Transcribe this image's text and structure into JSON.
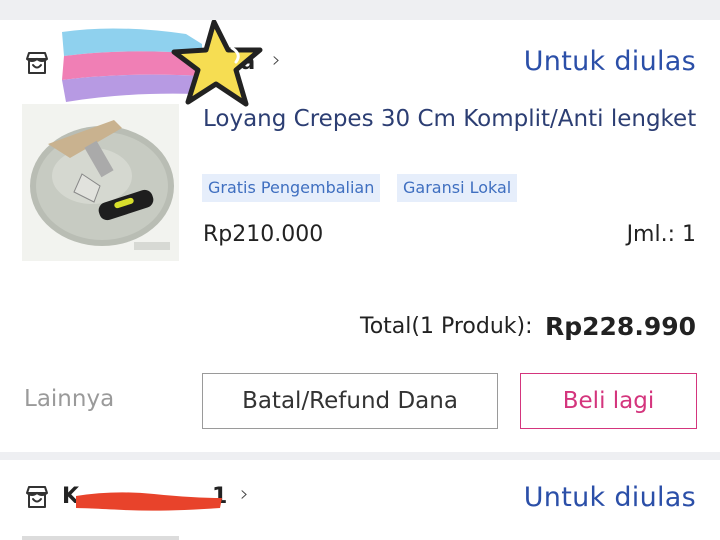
{
  "orders": [
    {
      "store_name": "ya",
      "status": "Untuk diulas",
      "product": {
        "title": "Loyang Crepes 30 Cm Komplit/Anti lengket",
        "badges": [
          "Gratis Pengembalian",
          "Garansi Lokal"
        ],
        "price": "Rp210.000",
        "qty": "Jml.: 1"
      },
      "total_label": "Total(1 Produk):",
      "total_value": "Rp228.990",
      "more_label": "Lainnya",
      "refund_label": "Batal/Refund Dana",
      "buy_again_label": "Beli lagi"
    },
    {
      "store_name": "K",
      "store_name_end": "1",
      "status": "Untuk diulas"
    }
  ],
  "icons": [
    "store-icon",
    "chevron-right-icon"
  ],
  "colors": {
    "accent": "#d4357d",
    "status_text": "#2b4fa8",
    "badge_bg": "#e6eefb",
    "badge_text": "#3f6fc0",
    "redaction": "#e8432b"
  }
}
